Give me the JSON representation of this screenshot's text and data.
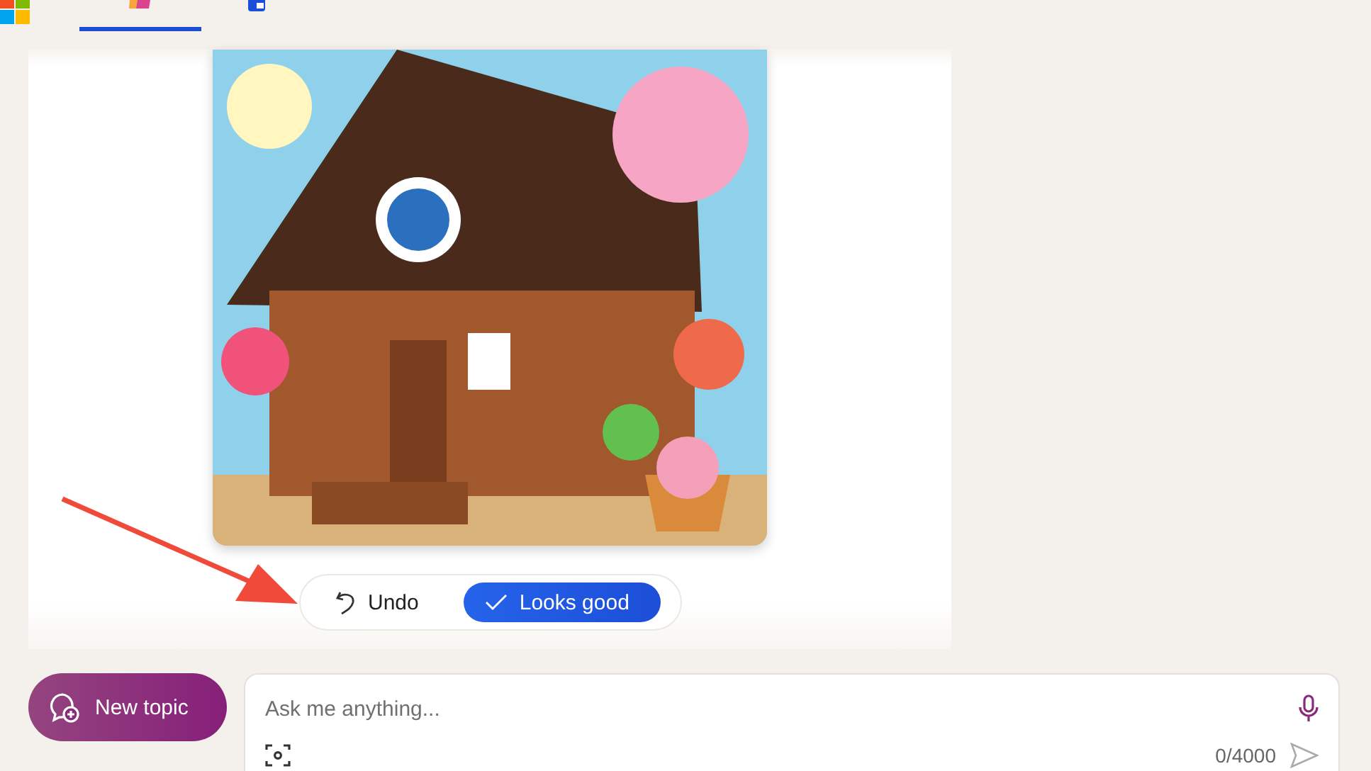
{
  "tabs": [
    {
      "kind": "copilot",
      "selected": true
    },
    {
      "kind": "notebook",
      "selected": false
    }
  ],
  "actions": [
    {
      "kind": "undo",
      "label": "Undo"
    },
    {
      "kind": "confirm",
      "label": "Looks good"
    }
  ],
  "new_topic": {
    "label": "New topic"
  },
  "composer": {
    "placeholder": "Ask me anything...",
    "counter": "0/4000"
  }
}
